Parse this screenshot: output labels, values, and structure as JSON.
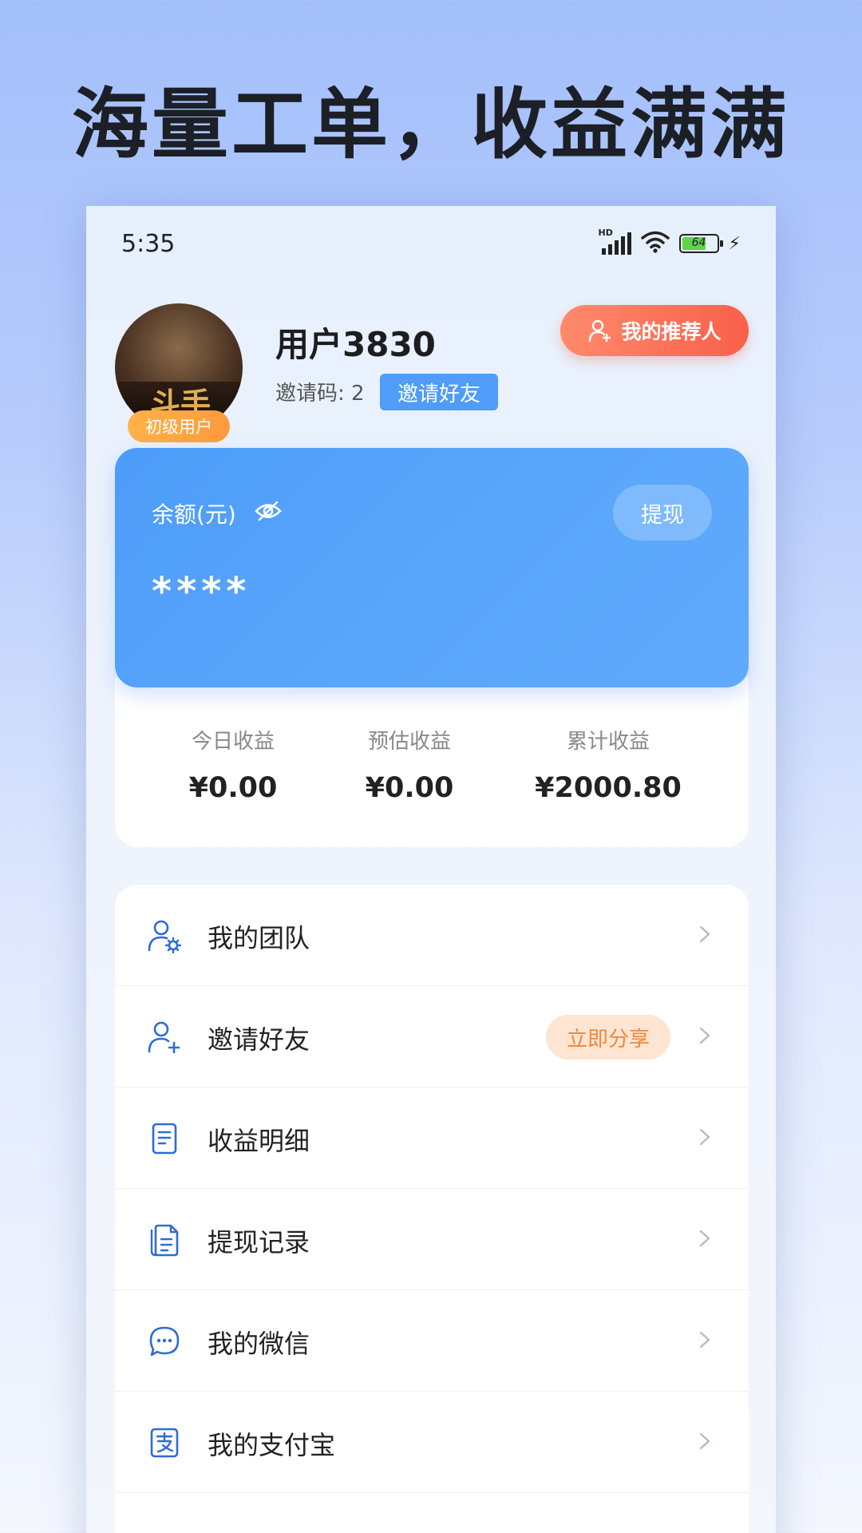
{
  "headline": "海量工单，收益满满",
  "status_bar": {
    "time": "5:35",
    "network_label": "HD",
    "battery_level": "64"
  },
  "profile": {
    "username": "用户3830",
    "level_badge": "初级用户",
    "invite_code_text": "邀请码: 2",
    "invite_button": "邀请好友",
    "referrer_button": "我的推荐人",
    "avatar_caption": "斗手"
  },
  "balance": {
    "label": "余额(元)",
    "amount": "****",
    "withdraw_button": "提现"
  },
  "stats": [
    {
      "label": "今日收益",
      "value": "¥0.00"
    },
    {
      "label": "预估收益",
      "value": "¥0.00"
    },
    {
      "label": "累计收益",
      "value": "¥2000.80"
    }
  ],
  "menu": [
    {
      "label": "我的团队",
      "icon": "team-settings-icon"
    },
    {
      "label": "邀请好友",
      "icon": "add-user-icon",
      "badge": "立即分享"
    },
    {
      "label": "收益明细",
      "icon": "document-list-icon"
    },
    {
      "label": "提现记录",
      "icon": "records-icon"
    },
    {
      "label": "我的微信",
      "icon": "chat-bubble-icon"
    },
    {
      "label": "我的支付宝",
      "icon": "alipay-icon"
    }
  ],
  "colors": {
    "accent_blue": "#4f9cf9",
    "referrer_red": "#f9604a",
    "badge_orange": "#ff9a3c",
    "icon_blue": "#2f6bd6"
  }
}
